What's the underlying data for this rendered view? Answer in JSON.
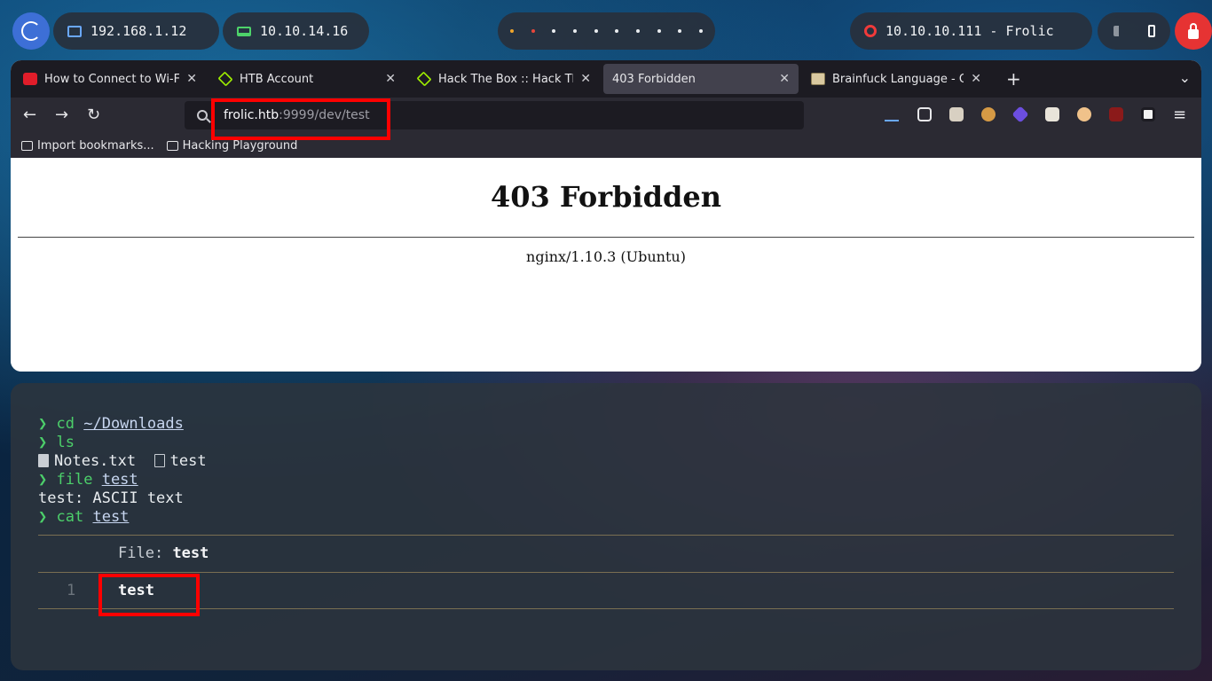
{
  "topbar": {
    "ip_local": "192.168.1.12",
    "ip_vpn": "10.10.14.16",
    "target": "10.10.10.111 - Frolic",
    "workspaces": 10
  },
  "browser": {
    "tabs": [
      {
        "title": "How to Connect to Wi-Fi Th",
        "favicon": "red-badge"
      },
      {
        "title": "HTB Account",
        "favicon": "htb-cube"
      },
      {
        "title": "Hack The Box :: Hack The B",
        "favicon": "htb-cube"
      },
      {
        "title": "403 Forbidden",
        "favicon": "none",
        "active": true
      },
      {
        "title": "Brainfuck Language - Onli",
        "favicon": "brainfuck"
      }
    ],
    "url_host": "frolic.htb",
    "url_rest": ":9999/dev/test",
    "bookmarks": [
      "Import bookmarks...",
      "Hacking Playground"
    ],
    "page": {
      "heading": "403 Forbidden",
      "server": "nginx/1.10.3 (Ubuntu)"
    }
  },
  "terminal": {
    "prompt": "❯",
    "cmd1": "cd",
    "cmd1_arg": "~/Downloads",
    "cmd2": "ls",
    "files": [
      "Notes.txt",
      "test"
    ],
    "cmd3": "file",
    "cmd3_arg": "test",
    "out3": "test: ASCII text",
    "cmd4": "cat",
    "cmd4_arg": "test",
    "bat_file_label": "File:",
    "bat_file_name": "test",
    "bat_line_num": "1",
    "bat_line": "test"
  },
  "colors": {
    "accent_red": "#ff0000",
    "prompt_green": "#4ccf6a",
    "htb_green": "#9fef00"
  }
}
